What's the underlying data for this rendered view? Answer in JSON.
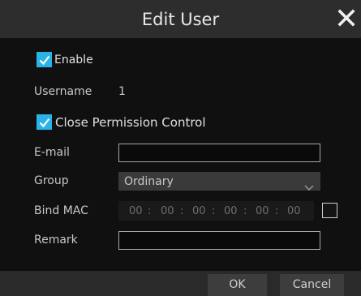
{
  "dialog": {
    "title": "Edit User",
    "close_icon": "close-icon"
  },
  "enable": {
    "label": "Enable",
    "checked": true
  },
  "username": {
    "label": "Username",
    "value": "1"
  },
  "close_permission": {
    "label": "Close Permission Control",
    "checked": true
  },
  "email": {
    "label": "E-mail",
    "value": ""
  },
  "group": {
    "label": "Group",
    "value": "Ordinary",
    "icon": "chevron-down-icon"
  },
  "bind_mac": {
    "label": "Bind MAC",
    "segments": [
      "00",
      "00",
      "00",
      "00",
      "00",
      "00"
    ],
    "separator": ":",
    "checked": false
  },
  "remark": {
    "label": "Remark",
    "value": ""
  },
  "buttons": {
    "ok": "OK",
    "cancel": "Cancel"
  },
  "colors": {
    "accent": "#2ab3e8",
    "titlebar": "#2d2d2d",
    "background": "#101010"
  }
}
